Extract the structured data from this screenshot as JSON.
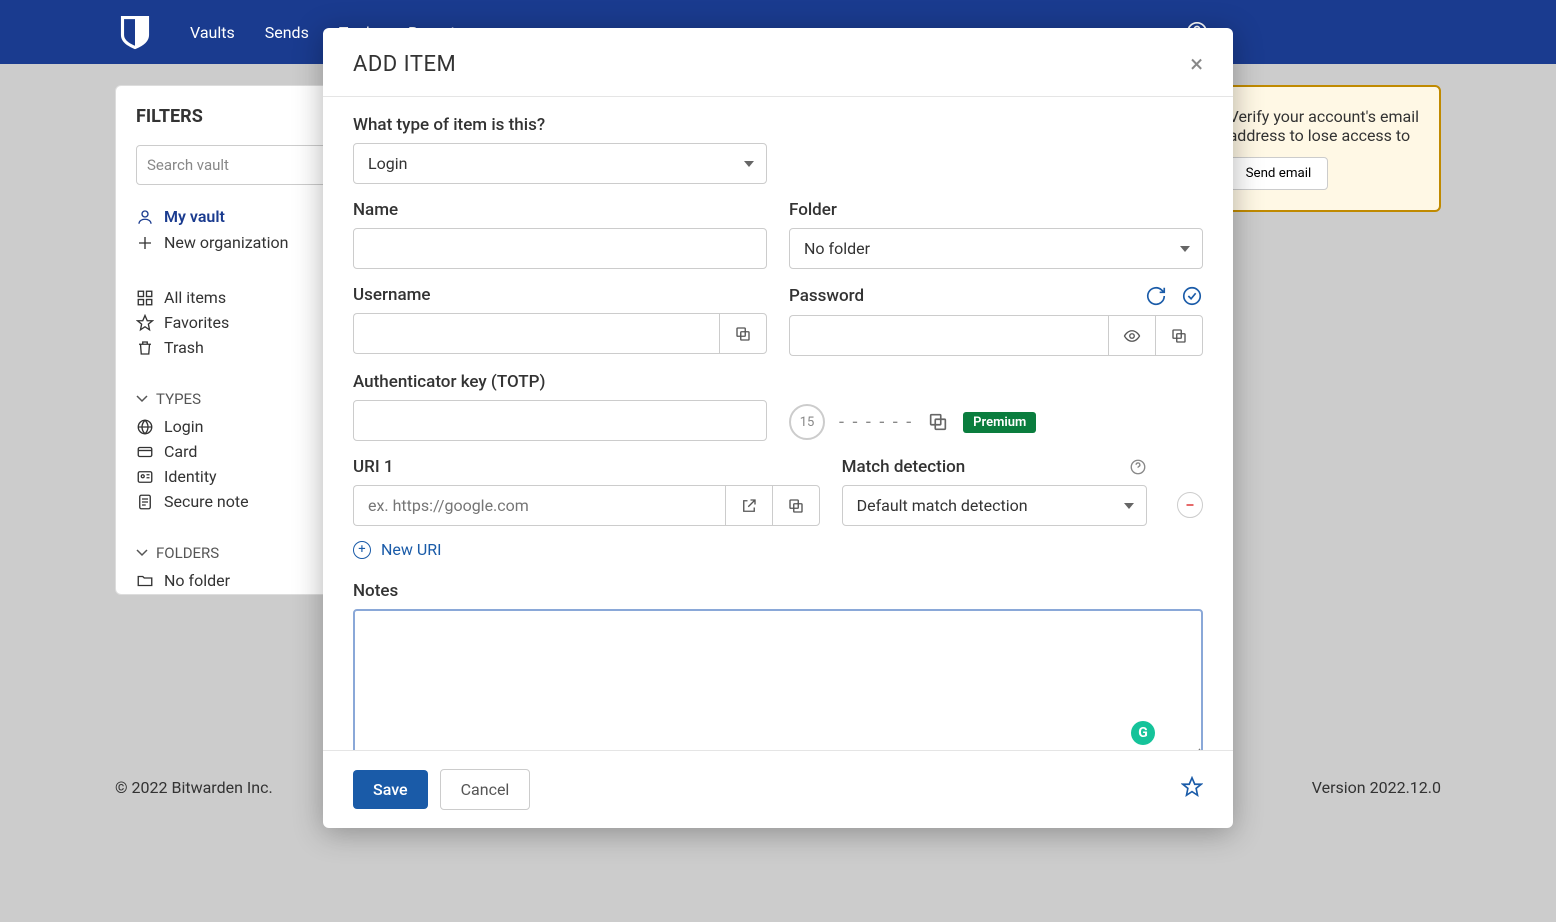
{
  "topnav": {
    "items": [
      "Vaults",
      "Sends",
      "Tools",
      "Reports"
    ]
  },
  "sidebar": {
    "filters_title": "FILTERS",
    "search_placeholder": "Search vault",
    "my_vault": "My vault",
    "new_org": "New organization",
    "all_items": "All items",
    "favorites": "Favorites",
    "trash": "Trash",
    "types_title": "TYPES",
    "types": {
      "login": "Login",
      "card": "Card",
      "identity": "Identity",
      "secure_note": "Secure note"
    },
    "folders_title": "FOLDERS",
    "no_folder": "No folder"
  },
  "email_banner": {
    "line1": "Verify your account's email",
    "line2": "address to lose access to",
    "btn": "Send email"
  },
  "footer": {
    "left": "© 2022 Bitwarden Inc.",
    "right": "Version 2022.12.0"
  },
  "modal": {
    "title": "ADD ITEM",
    "type_label": "What type of item is this?",
    "type_value": "Login",
    "name_label": "Name",
    "folder_label": "Folder",
    "folder_value": "No folder",
    "username_label": "Username",
    "password_label": "Password",
    "totp_label": "Authenticator key (TOTP)",
    "totp_timer": "15",
    "totp_code": "- - -   - - -",
    "premium": "Premium",
    "uri_label": "URI 1",
    "uri_placeholder": "ex. https://google.com",
    "match_label": "Match detection",
    "match_value": "Default match detection",
    "new_uri": "New URI",
    "notes_label": "Notes",
    "save": "Save",
    "cancel": "Cancel"
  }
}
